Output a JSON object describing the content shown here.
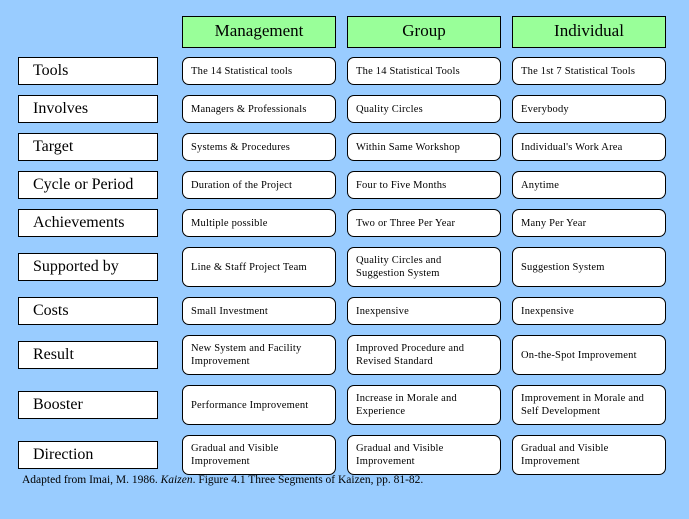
{
  "diagram": {
    "background_color": "#99ccff",
    "header_fill_color": "#99ff99",
    "box_fill_color": "#ffffff",
    "border_color": "#000000",
    "column_headers": [
      {
        "label": "Management"
      },
      {
        "label": "Group"
      },
      {
        "label": "Individual"
      }
    ],
    "rows": [
      {
        "label": "Tools",
        "management": "The 14 Statistical tools",
        "group": "The 14 Statistical Tools",
        "individual": "The 1st 7 Statistical Tools",
        "two_line": false
      },
      {
        "label": "Involves",
        "management": "Managers & Professionals",
        "group": "Quality Circles",
        "individual": "Everybody",
        "two_line": false
      },
      {
        "label": "Target",
        "management": "Systems & Procedures",
        "group": "Within Same Workshop",
        "individual": "Individual's Work Area",
        "two_line": false
      },
      {
        "label": "Cycle or Period",
        "management": "Duration of the Project",
        "group": "Four to Five Months",
        "individual": "Anytime",
        "two_line": false
      },
      {
        "label": "Achievements",
        "management": "Multiple possible",
        "group": "Two or Three Per Year",
        "individual": "Many Per Year",
        "two_line": false
      },
      {
        "label": "Supported by",
        "management": "Line & Staff Project Team",
        "group": "Quality Circles and Suggestion System",
        "individual": "Suggestion System",
        "two_line": true
      },
      {
        "label": "Costs",
        "management": "Small Investment",
        "group": "Inexpensive",
        "individual": "Inexpensive",
        "two_line": false
      },
      {
        "label": "Result",
        "management": "New System and Facility Improvement",
        "group": "Improved Procedure and Revised Standard",
        "individual": "On-the-Spot Improvement",
        "two_line": true
      },
      {
        "label": "Booster",
        "management": "Performance Improvement",
        "group": "Increase in Morale and Experience",
        "individual": "Improvement in Morale and Self Development",
        "two_line": true
      },
      {
        "label": "Direction",
        "management": "Gradual and Visible Improvement",
        "group": "Gradual and Visible Improvement",
        "individual": "Gradual and Visible Improvement",
        "two_line": true
      }
    ],
    "footnote": {
      "part1": "Adapted from Imai, M. 1986. ",
      "italic": "Kaizen",
      "part2": ". Figure 4.1 Three Segments of Kaizen, pp.  81-82."
    }
  }
}
